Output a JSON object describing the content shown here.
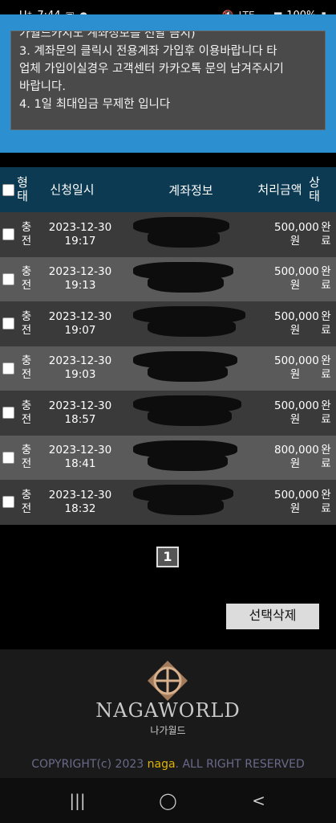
{
  "status_bar": {
    "carrier": "U⁺",
    "time": "7:44",
    "network": "LTE",
    "battery": "100%"
  },
  "notice": {
    "lines": [
      "가월드카지노 계좌정보를 전달 금지)",
      "3. 계좌문의 클릭시 전용계좌 가입후 이용바랍니다 타",
      "업체 가입이실경우 고객센터 카카오톡 문의 남겨주시기",
      "바랍니다.",
      "4. 1일 최대입금 무제한 입니다"
    ]
  },
  "table": {
    "headers": {
      "type": "형태",
      "date": "신청일시",
      "account": "계좌정보",
      "amount": "처리금액",
      "status": "상태"
    },
    "rows": [
      {
        "type": "충전",
        "date": "2023-12-30",
        "time": "19:17",
        "amount": "500,000",
        "unit": "원",
        "status": "완료"
      },
      {
        "type": "충전",
        "date": "2023-12-30",
        "time": "19:13",
        "amount": "500,000",
        "unit": "원",
        "status": "완료"
      },
      {
        "type": "충전",
        "date": "2023-12-30",
        "time": "19:07",
        "amount": "500,000",
        "unit": "원",
        "status": "완료"
      },
      {
        "type": "충전",
        "date": "2023-12-30",
        "time": "19:03",
        "amount": "500,000",
        "unit": "원",
        "status": "완료"
      },
      {
        "type": "충전",
        "date": "2023-12-30",
        "time": "18:57",
        "amount": "500,000",
        "unit": "원",
        "status": "완료"
      },
      {
        "type": "충전",
        "date": "2023-12-30",
        "time": "18:41",
        "amount": "800,000",
        "unit": "원",
        "status": "완료"
      },
      {
        "type": "충전",
        "date": "2023-12-30",
        "time": "18:32",
        "amount": "500,000",
        "unit": "원",
        "status": "완료"
      }
    ]
  },
  "pagination": {
    "current": "1"
  },
  "actions": {
    "delete_selected": "선택삭제"
  },
  "footer": {
    "brand": "NAGAWORLD",
    "brand_sub": "나가월드",
    "copyright_prefix": "COPYRIGHT(c) 2023 ",
    "copyright_highlight": "naga",
    "copyright_suffix": ". ALL RIGHT RESERVED"
  },
  "colors": {
    "accent_blue": "#2b8fd0",
    "header_navy": "#0b3a52",
    "highlight_gold": "#e0b400"
  }
}
